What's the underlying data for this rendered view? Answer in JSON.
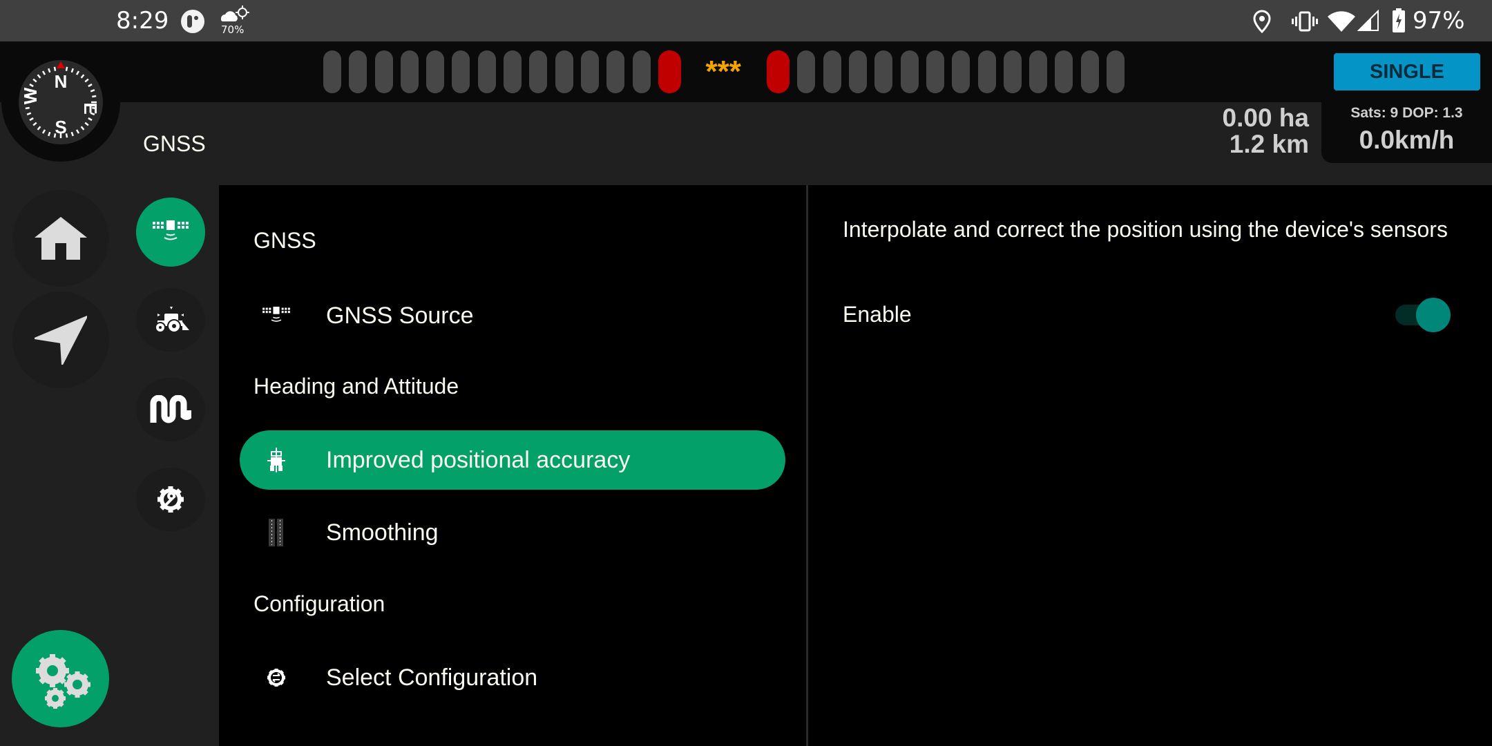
{
  "status_bar": {
    "time": "8:29",
    "weather_percent": "70%",
    "battery_percent": "97%",
    "icons": [
      "app-notification-icon",
      "weather-icon",
      "location-icon",
      "vibrate-icon",
      "wifi-icon",
      "cell-signal-icon",
      "battery-charging-icon"
    ]
  },
  "top_bar": {
    "lightbar": {
      "left_segments": 13,
      "right_segments": 13,
      "center_indicator": "***",
      "active_color": "#c00000",
      "inactive_color": "#474747",
      "indicator_color": "#f5a300"
    },
    "fix_mode": "SINGLE",
    "fix_mode_color": "#0495c6"
  },
  "compass": {
    "north": "N",
    "east": "E",
    "south": "S",
    "west": "W"
  },
  "header": {
    "title": "GNSS",
    "area": "0.00 ha",
    "distance": "1.2 km",
    "sats_dop": "Sats: 9  DOP: 1.3",
    "speed": "0.0km/h"
  },
  "left_rail": {
    "buttons": [
      {
        "name": "home",
        "icon": "home-icon"
      },
      {
        "name": "navigate",
        "icon": "navigation-arrow-icon"
      },
      {
        "name": "settings",
        "icon": "gears-icon",
        "accent": "#04a06a"
      }
    ],
    "categories": [
      {
        "name": "gnss",
        "icon": "satellite-icon",
        "active": true
      },
      {
        "name": "vehicle",
        "icon": "tractor-icon",
        "active": false
      },
      {
        "name": "guidance",
        "icon": "serpentine-path-icon",
        "active": false
      },
      {
        "name": "tools",
        "icon": "wrench-gear-icon",
        "active": false
      }
    ]
  },
  "menu": {
    "sections": [
      {
        "title": "GNSS",
        "items": [
          {
            "label": "GNSS Source",
            "icon": "satellite-icon",
            "active": false
          }
        ]
      },
      {
        "title": "Heading and Attitude",
        "items": [
          {
            "label": "Improved positional accuracy",
            "icon": "tractor-crosshair-icon",
            "active": true
          },
          {
            "label": "Smoothing",
            "icon": "smoothing-lanes-icon",
            "active": false
          }
        ]
      },
      {
        "title": "Configuration",
        "items": [
          {
            "label": "Select Configuration",
            "icon": "config-swap-gear-icon",
            "active": false
          }
        ]
      }
    ],
    "accent_color": "#04a06a"
  },
  "detail": {
    "description": "Interpolate and correct the position using the device's sensors",
    "enable_label": "Enable",
    "enable_value": true,
    "toggle_color": "#01877a"
  }
}
